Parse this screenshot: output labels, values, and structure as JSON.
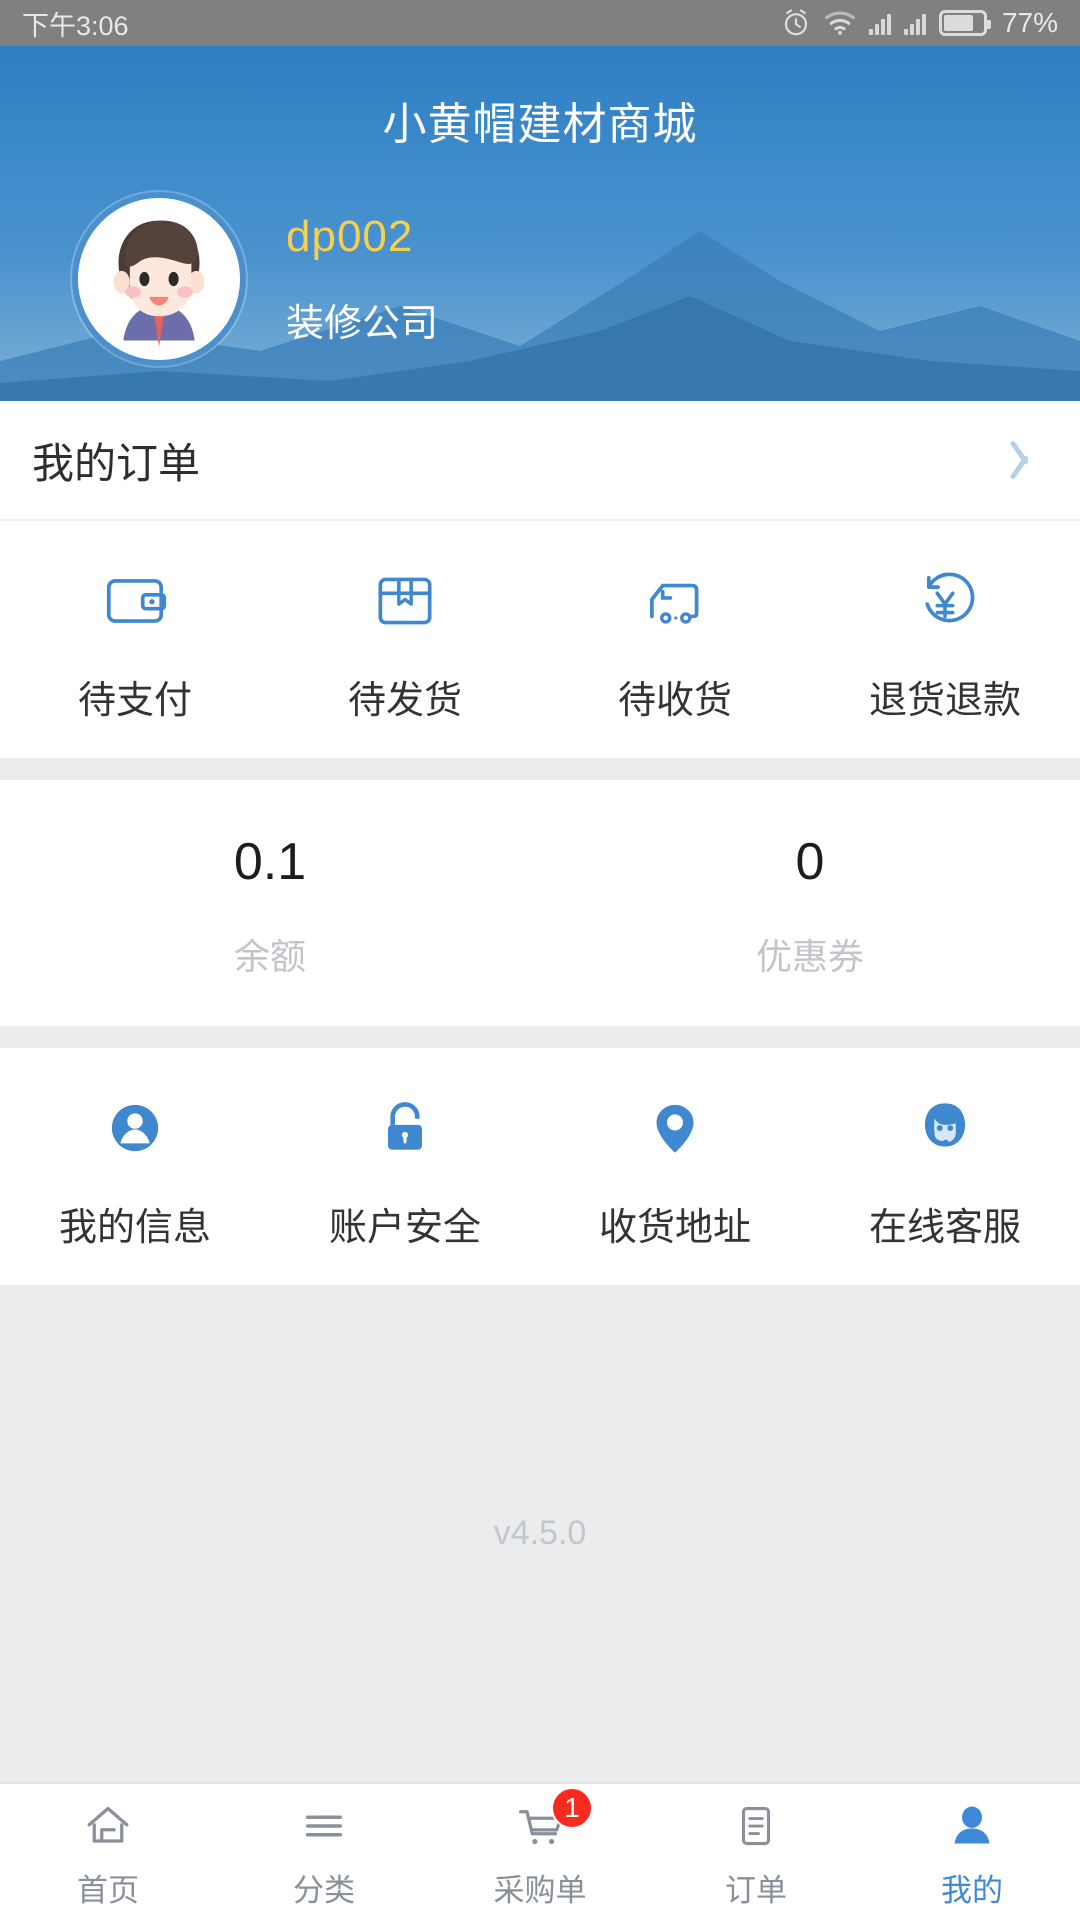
{
  "status_bar": {
    "time": "下午3:06",
    "battery_percent": "77%",
    "icons": [
      "alarm-icon",
      "wifi-icon",
      "signal-icon",
      "signal-icon",
      "battery-icon"
    ]
  },
  "header": {
    "title": "小黄帽建材商城",
    "username": "dp002",
    "role": "装修公司",
    "username_color": "#f5cf4e",
    "background_color": "#3f8ecd"
  },
  "my_orders": {
    "title": "我的订单",
    "chevron": "chevron-right-icon",
    "statuses": [
      {
        "label": "待支付",
        "icon": "wallet-icon"
      },
      {
        "label": "待发货",
        "icon": "package-box-icon"
      },
      {
        "label": "待收货",
        "icon": "delivery-truck-icon"
      },
      {
        "label": "退货退款",
        "icon": "refund-yen-icon"
      }
    ]
  },
  "wallet": {
    "items": [
      {
        "value": "0.1",
        "label": "余额"
      },
      {
        "value": "0",
        "label": "优惠券"
      }
    ]
  },
  "services": {
    "items": [
      {
        "label": "我的信息",
        "icon": "user-circle-icon"
      },
      {
        "label": "账户安全",
        "icon": "lock-icon"
      },
      {
        "label": "收货地址",
        "icon": "location-pin-icon"
      },
      {
        "label": "在线客服",
        "icon": "customer-service-icon"
      }
    ]
  },
  "footer": {
    "version": "v4.5.0"
  },
  "tabbar": {
    "items": [
      {
        "label": "首页",
        "icon": "home-icon",
        "active": false,
        "badge": ""
      },
      {
        "label": "分类",
        "icon": "category-lines-icon",
        "active": false,
        "badge": ""
      },
      {
        "label": "采购单",
        "icon": "shopping-cart-icon",
        "active": false,
        "badge": "1"
      },
      {
        "label": "订单",
        "icon": "order-document-icon",
        "active": false,
        "badge": ""
      },
      {
        "label": "我的",
        "icon": "person-icon",
        "active": true,
        "badge": ""
      }
    ],
    "active_color": "#3f8ad8",
    "badge_color": "#fa2a20"
  }
}
